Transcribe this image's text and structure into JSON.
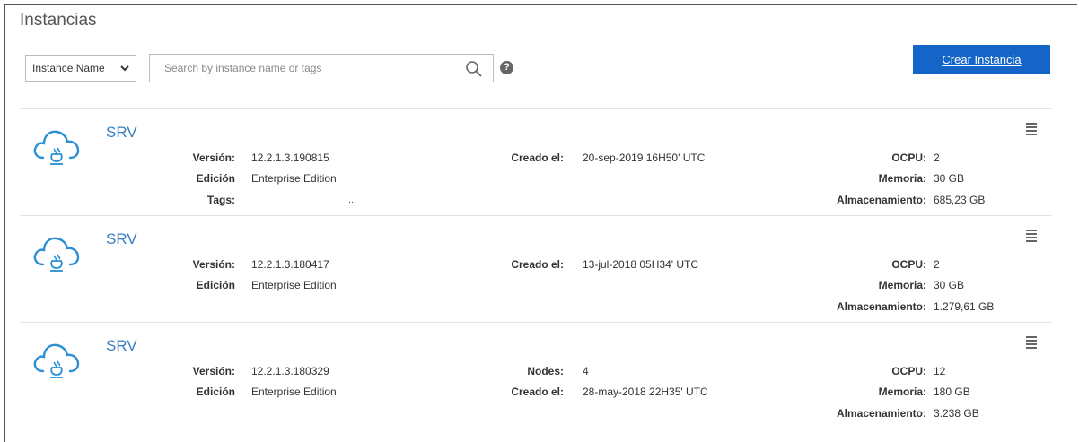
{
  "page": {
    "title": "Instancias"
  },
  "toolbar": {
    "filter_selected": "Instance Name",
    "search_placeholder": "Search by instance name or tags",
    "help": "?",
    "create_label": "Crear Instancia"
  },
  "instances": [
    {
      "name": "SRV",
      "left": [
        {
          "label": "Versión:",
          "value": "12.2.1.3.190815"
        },
        {
          "label": "Edición",
          "value": "Enterprise Edition"
        },
        {
          "label": "Tags:",
          "value": "..."
        }
      ],
      "middle": [
        {
          "label": "Creado el:",
          "value": "20-sep-2019 16H50' UTC"
        }
      ],
      "right": [
        {
          "label": "OCPU:",
          "value": "2"
        },
        {
          "label": "Memoria:",
          "value": "30 GB"
        },
        {
          "label": "Almacenamiento:",
          "value": "685,23 GB"
        }
      ]
    },
    {
      "name": "SRV",
      "left": [
        {
          "label": "Versión:",
          "value": "12.2.1.3.180417"
        },
        {
          "label": "Edición",
          "value": "Enterprise Edition"
        }
      ],
      "middle": [
        {
          "label": "Creado el:",
          "value": "13-jul-2018 05H34' UTC"
        }
      ],
      "right": [
        {
          "label": "OCPU:",
          "value": "2"
        },
        {
          "label": "Memoria:",
          "value": "30 GB"
        },
        {
          "label": "Almacenamiento:",
          "value": "1.279,61 GB"
        }
      ]
    },
    {
      "name": "SRV",
      "left": [
        {
          "label": "Versión:",
          "value": "12.2.1.3.180329"
        },
        {
          "label": "Edición",
          "value": "Enterprise Edition"
        }
      ],
      "middle": [
        {
          "label": "Nodes:",
          "value": "4"
        },
        {
          "label": "Creado el:",
          "value": "28-may-2018 22H35' UTC"
        }
      ],
      "right": [
        {
          "label": "OCPU:",
          "value": "12"
        },
        {
          "label": "Memoria:",
          "value": "180 GB"
        },
        {
          "label": "Almacenamiento:",
          "value": "3.238 GB"
        }
      ]
    }
  ],
  "colors": {
    "accent": "#1565c8",
    "link": "#3a7fc2",
    "icon": "#2b8fd6"
  }
}
